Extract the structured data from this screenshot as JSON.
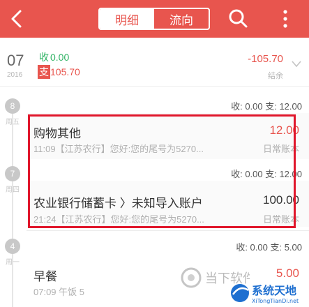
{
  "header": {
    "tabs": [
      {
        "label": "明细",
        "active": true
      },
      {
        "label": "流向",
        "active": false
      }
    ],
    "accent": "#e8554e"
  },
  "summary": {
    "day": "07",
    "year": "2016",
    "income_label": "收",
    "income_value": "0.00",
    "expense_label": "支",
    "expense_value": "105.70",
    "balance": "-105.70",
    "balance_label": "结余"
  },
  "days": [
    {
      "date": "8",
      "weekday": "周五",
      "totals": "收: 0.00 支: 12.00",
      "transactions": [
        {
          "title": "购物其他",
          "amount": "12.00",
          "amount_color": "#e8554e",
          "note": "11:09【江苏农行】您好:您的尾号为5270...",
          "category": "日常账本"
        }
      ]
    },
    {
      "date": "7",
      "weekday": "周四",
      "totals": "收: 0.00 支: 12.00",
      "transactions": [
        {
          "title": "农业银行储蓄卡 〉未知导入账户",
          "amount": "100.00",
          "amount_color": "#333333",
          "note": "21:24【江苏农行】您好:您的尾号为5270...",
          "category": "日常账本"
        }
      ]
    },
    {
      "date": "4",
      "weekday": "周一",
      "totals": "收: 0.00 支: 5.00",
      "transactions": [
        {
          "title": "早餐",
          "amount": "5.00",
          "amount_color": "#e8554e",
          "note": "07:09 午饭 5",
          "category": ""
        }
      ]
    }
  ],
  "watermark": {
    "site1": "当下软件园",
    "site2": "系统天地",
    "site2_url": "XiTongTianDi.net"
  }
}
